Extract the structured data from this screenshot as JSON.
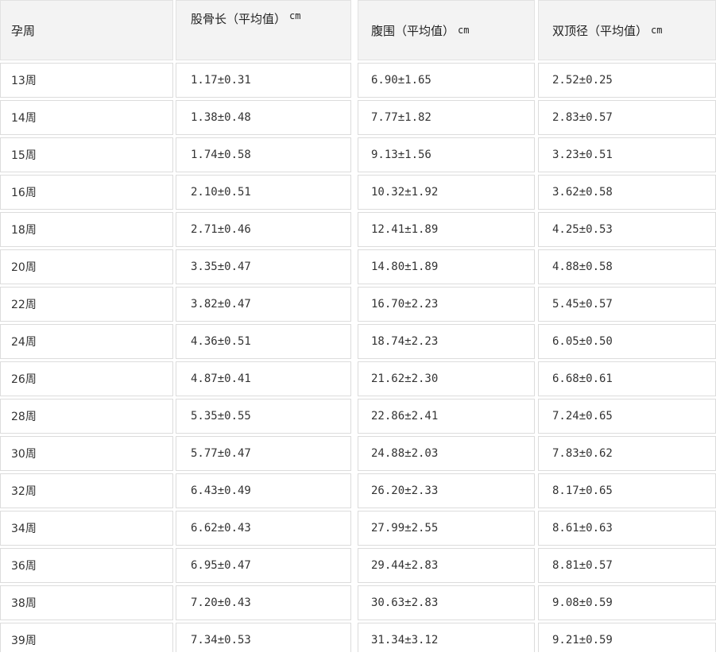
{
  "table": {
    "headers": [
      {
        "label": "孕周",
        "unit": ""
      },
      {
        "label": "股骨长（平均值）",
        "unit": "cm"
      },
      {
        "label": "腹围（平均值）",
        "unit": "cm"
      },
      {
        "label": "双顶径（平均值）",
        "unit": "cm"
      }
    ],
    "rows": [
      [
        "13周",
        "1.17±0.31",
        "6.90±1.65",
        "2.52±0.25"
      ],
      [
        "14周",
        "1.38±0.48",
        "7.77±1.82",
        "2.83±0.57"
      ],
      [
        "15周",
        "1.74±0.58",
        "9.13±1.56",
        "3.23±0.51"
      ],
      [
        "16周",
        "2.10±0.51",
        "10.32±1.92",
        "3.62±0.58"
      ],
      [
        "18周",
        "2.71±0.46",
        "12.41±1.89",
        "4.25±0.53"
      ],
      [
        "20周",
        "3.35±0.47",
        "14.80±1.89",
        "4.88±0.58"
      ],
      [
        "22周",
        "3.82±0.47",
        "16.70±2.23",
        "5.45±0.57"
      ],
      [
        "24周",
        "4.36±0.51",
        "18.74±2.23",
        "6.05±0.50"
      ],
      [
        "26周",
        "4.87±0.41",
        "21.62±2.30",
        "6.68±0.61"
      ],
      [
        "28周",
        "5.35±0.55",
        "22.86±2.41",
        "7.24±0.65"
      ],
      [
        "30周",
        "5.77±0.47",
        "24.88±2.03",
        "7.83±0.62"
      ],
      [
        "32周",
        "6.43±0.49",
        "26.20±2.33",
        "8.17±0.65"
      ],
      [
        "34周",
        "6.62±0.43",
        "27.99±2.55",
        "8.61±0.63"
      ],
      [
        "36周",
        "6.95±0.47",
        "29.44±2.83",
        "8.81±0.57"
      ],
      [
        "38周",
        "7.20±0.43",
        "30.63±2.83",
        "9.08±0.59"
      ],
      [
        "39周",
        "7.34±0.53",
        "31.34±3.12",
        "9.21±0.59"
      ]
    ]
  }
}
